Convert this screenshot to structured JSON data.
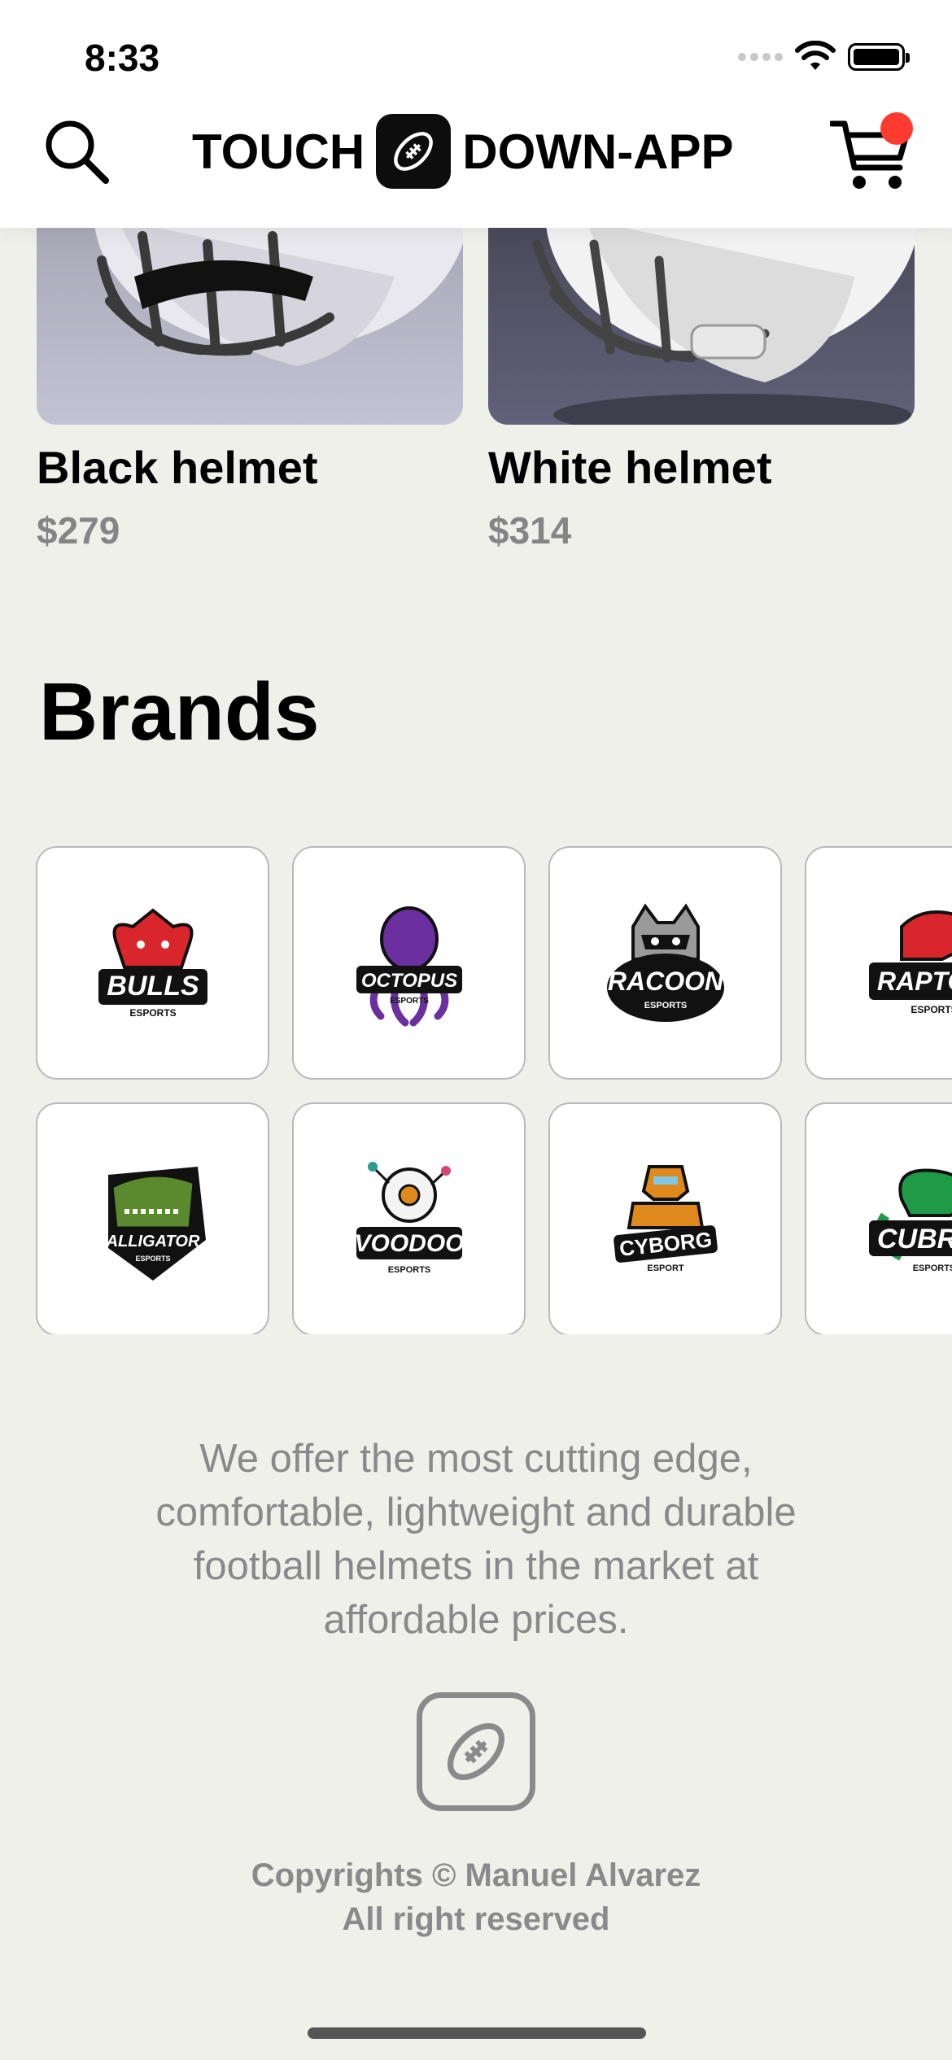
{
  "status_bar": {
    "time": "8:33"
  },
  "header": {
    "title_left": "TOUCH",
    "title_right": "DOWN-APP",
    "search_icon": "search-icon",
    "cart_icon": "cart-icon",
    "logo_icon": "football-icon",
    "cart_badge_color": "#ff3b30"
  },
  "products": [
    {
      "name": "Black helmet",
      "price": "$279"
    },
    {
      "name": "White helmet",
      "price": "$314"
    }
  ],
  "brands": {
    "title": "Brands",
    "items": [
      {
        "name": "BULLS",
        "tag": "ESPORTS",
        "color": "#d9262c"
      },
      {
        "name": "OCTOPUS",
        "tag": "ESPORTS",
        "color": "#6b2fa0"
      },
      {
        "name": "RACOON",
        "tag": "ESPORTS",
        "color": "#555555"
      },
      {
        "name": "RAPTO",
        "tag": "ESPORTS",
        "color": "#d9262c"
      },
      {
        "name": "ALLIGATOR",
        "tag": "ESPORTS",
        "color": "#5b8a2e"
      },
      {
        "name": "VOODOO",
        "tag": "ESPORTS",
        "color": "#7fb0d6"
      },
      {
        "name": "CYBORG",
        "tag": "ESPORT",
        "color": "#e08a1e"
      },
      {
        "name": "CUBR",
        "tag": "ESPORTS",
        "color": "#1f9a47"
      }
    ]
  },
  "footer": {
    "about": "We offer the most cutting edge, comfortable, lightweight and durable football helmets in the market at affordable prices.",
    "copyright_line1": "Copyrights © Manuel Alvarez",
    "copyright_line2": "All right reserved",
    "logo_icon": "football-icon"
  }
}
